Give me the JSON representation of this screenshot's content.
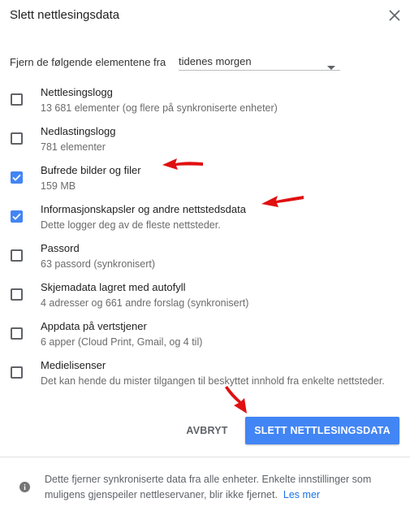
{
  "dialog": {
    "title": "Slett nettlesingsdata",
    "range_label": "Fjern de følgende elementene fra",
    "range_value": "tidenes morgen"
  },
  "items": [
    {
      "label": "Nettlesingslogg",
      "sub": "13 681 elementer (og flere på synkroniserte enheter)",
      "checked": false
    },
    {
      "label": "Nedlastingslogg",
      "sub": "781 elementer",
      "checked": false
    },
    {
      "label": "Bufrede bilder og filer",
      "sub": "159 MB",
      "checked": true
    },
    {
      "label": "Informasjonskapsler og andre nettstedsdata",
      "sub": "Dette logger deg av de fleste nettsteder.",
      "checked": true
    },
    {
      "label": "Passord",
      "sub": "63 passord (synkronisert)",
      "checked": false
    },
    {
      "label": "Skjemadata lagret med autofyll",
      "sub": "4 adresser og 661 andre forslag (synkronisert)",
      "checked": false
    },
    {
      "label": "Appdata på vertstjener",
      "sub": "6 apper (Cloud Print, Gmail, og 4 til)",
      "checked": false
    },
    {
      "label": "Medielisenser",
      "sub": "Det kan hende du mister tilgangen til beskyttet innhold fra enkelte nettsteder.",
      "checked": false
    }
  ],
  "buttons": {
    "cancel": "AVBRYT",
    "clear": "SLETT NETTLESINGSDATA"
  },
  "footer": {
    "text": "Dette fjerner synkroniserte data fra alle enheter. Enkelte innstillinger som muligens gjenspeiler nettleservaner, blir ikke fjernet.",
    "link": "Les mer"
  },
  "icons": {
    "close": "close-icon",
    "dropdown": "chevron-down-icon",
    "info": "info-icon",
    "annotation": "red-arrow-annotation"
  },
  "colors": {
    "accent": "#4285f4",
    "link": "#1a73e8",
    "annotation": "#e01010"
  }
}
